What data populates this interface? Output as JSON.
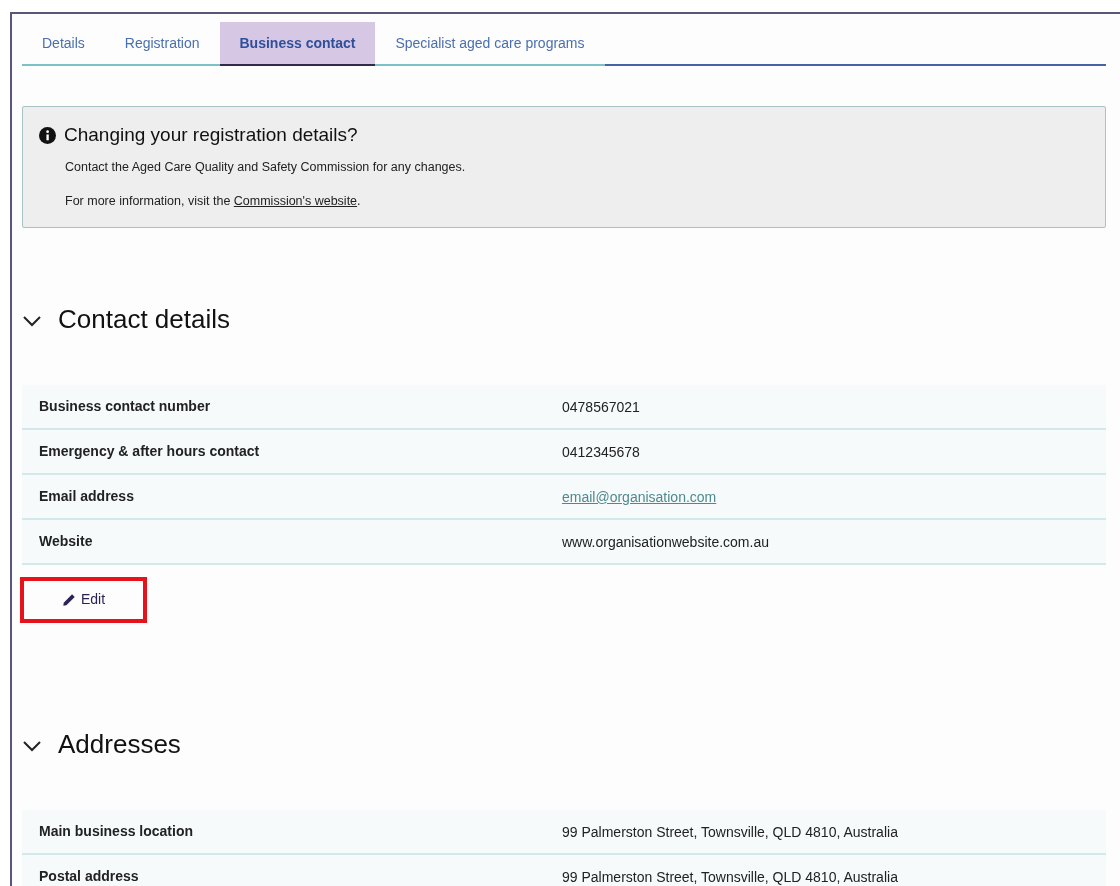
{
  "tabs": [
    {
      "label": "Details",
      "selected": false
    },
    {
      "label": "Registration",
      "selected": false
    },
    {
      "label": "Business contact",
      "selected": true
    },
    {
      "label": "Specialist aged care programs",
      "selected": false
    }
  ],
  "notice": {
    "title": "Changing your registration details?",
    "text": "Contact the Aged Care Quality and Safety Commission for any changes.",
    "more_text": "For more information, visit the ",
    "link": "Commission's website",
    "after_link": "."
  },
  "sections": [
    {
      "title": "Contact details",
      "expanded": true,
      "rows": [
        {
          "label": "Business contact number",
          "value": "0478567021",
          "kind": "text"
        },
        {
          "label": "Emergency & after hours contact",
          "value": "0412345678",
          "kind": "text"
        },
        {
          "label": "Email address",
          "value": "email@organisation.com",
          "kind": "link"
        },
        {
          "label": "Website",
          "value": "www.organisationwebsite.com.au",
          "kind": "text"
        }
      ],
      "edit": {
        "label": "Edit",
        "highlighted": true
      }
    },
    {
      "title": "Addresses",
      "expanded": true,
      "rows": [
        {
          "label": "Main business location",
          "value": "99 Palmerston Street, Townsville, QLD 4810, Australia",
          "kind": "text"
        },
        {
          "label": "Postal address",
          "value": "99 Palmerston Street, Townsville, QLD 4810, Australia",
          "kind": "text"
        }
      ]
    }
  ]
}
